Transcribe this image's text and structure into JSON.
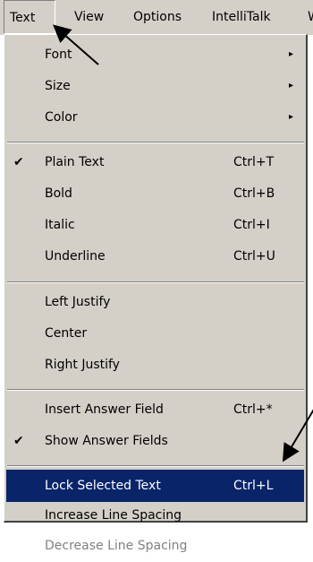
{
  "menubar": {
    "items": [
      "Text",
      "View",
      "Options",
      "IntelliTalk",
      "W"
    ]
  },
  "menu": {
    "font": {
      "label": "Font",
      "arrow": "▸"
    },
    "size": {
      "label": "Size",
      "arrow": "▸"
    },
    "color": {
      "label": "Color",
      "arrow": "▸"
    },
    "plain_text": {
      "label": "Plain Text",
      "shortcut": "Ctrl+T",
      "check": "✔"
    },
    "bold": {
      "label": "Bold",
      "shortcut": "Ctrl+B"
    },
    "italic": {
      "label": "Italic",
      "shortcut": "Ctrl+I"
    },
    "underline": {
      "label": "Underline",
      "shortcut": "Ctrl+U"
    },
    "left_justify": {
      "label": "Left Justify"
    },
    "center": {
      "label": "Center"
    },
    "right_justify": {
      "label": "Right Justify"
    },
    "insert_answer_field": {
      "label": "Insert Answer Field",
      "shortcut": "Ctrl+*"
    },
    "show_answer_fields": {
      "label": "Show Answer Fields",
      "check": "✔"
    },
    "lock_selected_text": {
      "label": "Lock Selected Text",
      "shortcut": "Ctrl+L"
    },
    "increase_line_spacing": {
      "label": "Increase Line Spacing"
    },
    "decrease_line_spacing": {
      "label": "Decrease Line Spacing"
    }
  },
  "colors": {
    "menu_bg": "#d4d0c8",
    "highlight_bg": "#0a246a",
    "highlight_text": "#ffffff",
    "disabled_text": "#808080"
  }
}
